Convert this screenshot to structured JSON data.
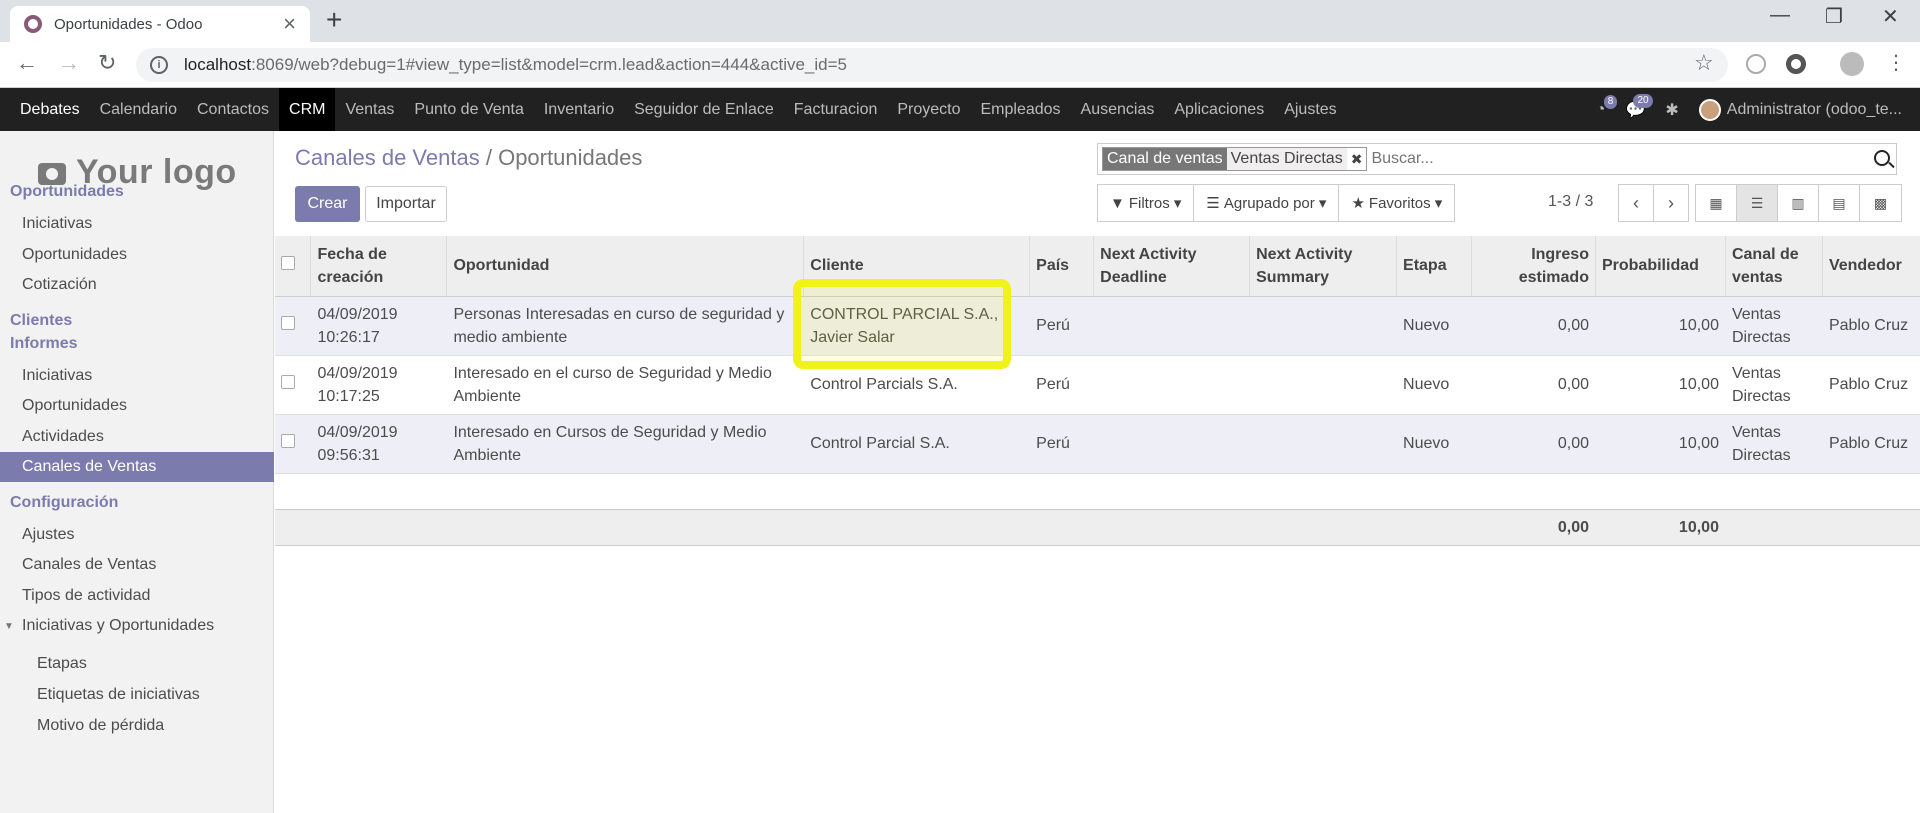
{
  "browser": {
    "tab_title": "Oportunidades - Odoo",
    "url_host": "localhost",
    "url_rest": ":8069/web?debug=1#view_type=list&model=crm.lead&action=444&active_id=5"
  },
  "topnav": {
    "brand": "Debates",
    "items": [
      "Calendario",
      "Contactos",
      "CRM",
      "Ventas",
      "Punto de Venta",
      "Inventario",
      "Seguidor de Enlace",
      "Facturacion",
      "Proyecto",
      "Empleados",
      "Ausencias",
      "Aplicaciones",
      "Ajustes"
    ],
    "active": "CRM",
    "messages_count": "8",
    "chat_count": "20",
    "user": "Administrator (odoo_te..."
  },
  "sidebar": {
    "logo": "Your logo",
    "sections": [
      {
        "head": "Oportunidades",
        "items": [
          "Iniciativas",
          "Oportunidades",
          "Cotización"
        ]
      },
      {
        "head": "Clientes",
        "items": []
      },
      {
        "head": "Informes",
        "items": [
          "Iniciativas",
          "Oportunidades",
          "Actividades",
          "Canales de Ventas"
        ]
      },
      {
        "head": "Configuración",
        "items": [
          "Ajustes",
          "Canales de Ventas",
          "Tipos de actividad",
          "Iniciativas y Oportunidades"
        ]
      },
      {
        "sub": [
          "Etapas",
          "Etiquetas de iniciativas",
          "Motivo de pérdida"
        ]
      }
    ],
    "selected": "Canales de Ventas"
  },
  "main": {
    "breadcrumb_parent": "Canales de Ventas",
    "breadcrumb_sep": "/",
    "breadcrumb_current": "Oportunidades",
    "create_label": "Crear",
    "import_label": "Importar",
    "facet_name": "Canal de ventas",
    "facet_value": "Ventas Directas",
    "search_placeholder": "Buscar...",
    "filters_label": "Filtros",
    "groupby_label": "Agrupado por",
    "favorites_label": "Favoritos",
    "pager": "1-3 / 3"
  },
  "table": {
    "headers": [
      "Fecha de creación",
      "Oportunidad",
      "Cliente",
      "País",
      "Next Activity Deadline",
      "Next Activity Summary",
      "Etapa",
      "Ingreso estimado",
      "Probabilidad",
      "Canal de ventas",
      "Vendedor"
    ],
    "rows": [
      {
        "date": "04/09/2019",
        "time": "10:26:17",
        "opp": "Personas Interesadas en curso de seguridad y medio ambiente",
        "client1": "CONTROL PARCIAL S.A.,",
        "client2": "Javier Salar",
        "country": "Perú",
        "deadline": "",
        "summary": "",
        "stage": "Nuevo",
        "revenue": "0,00",
        "prob": "10,00",
        "channel1": "Ventas",
        "channel2": "Directas",
        "seller": "Pablo Cruz"
      },
      {
        "date": "04/09/2019",
        "time": "10:17:25",
        "opp": "Interesado en el curso de Seguridad y Medio Ambiente",
        "client1": "Control Parcials S.A.",
        "client2": "",
        "country": "Perú",
        "deadline": "",
        "summary": "",
        "stage": "Nuevo",
        "revenue": "0,00",
        "prob": "10,00",
        "channel1": "Ventas",
        "channel2": "Directas",
        "seller": "Pablo Cruz"
      },
      {
        "date": "04/09/2019",
        "time": "09:56:31",
        "opp": "Interesado en Cursos de Seguridad y Medio Ambiente",
        "client1": "Control Parcial S.A.",
        "client2": "",
        "country": "Perú",
        "deadline": "",
        "summary": "",
        "stage": "Nuevo",
        "revenue": "0,00",
        "prob": "10,00",
        "channel1": "Ventas",
        "channel2": "Directas",
        "seller": "Pablo Cruz"
      }
    ],
    "total_revenue": "0,00",
    "total_prob": "10,00"
  },
  "colors": {
    "accent": "#7c7bad",
    "navbar": "#212121",
    "highlight": "#f2f21b"
  }
}
